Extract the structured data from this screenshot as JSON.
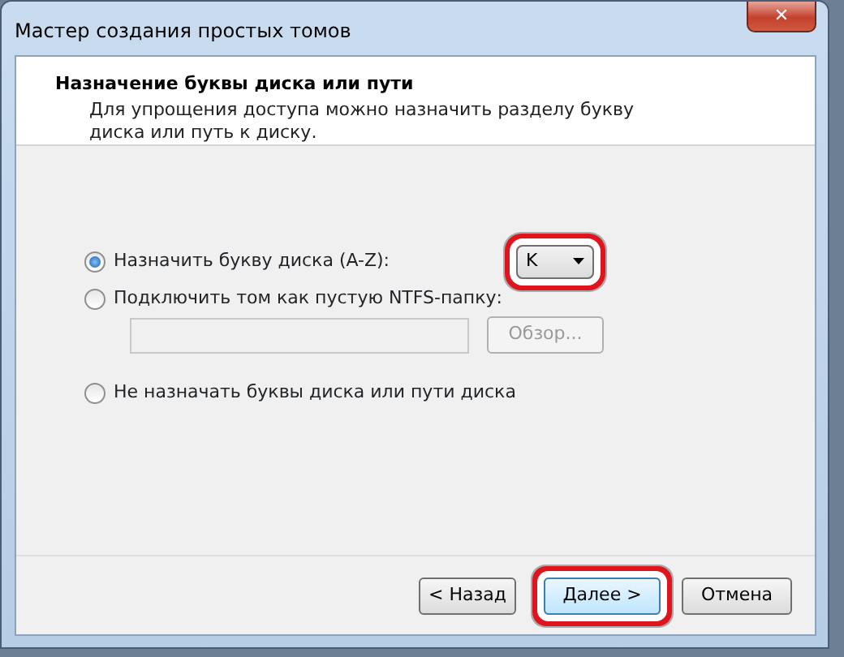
{
  "window": {
    "title": "Мастер создания простых томов",
    "close": "✕"
  },
  "header": {
    "title": "Назначение буквы диска или пути",
    "description": "Для упрощения доступа можно назначить разделу букву диска или путь к диску."
  },
  "options": [
    {
      "label": "Назначить букву диска (A-Z):",
      "selected": true
    },
    {
      "label": "Подключить том как пустую NTFS-папку:",
      "selected": false
    },
    {
      "label": "Не назначать буквы диска или пути диска",
      "selected": false
    }
  ],
  "drive_letter": {
    "value": "K",
    "highlighted": true
  },
  "folder_path": {
    "disabled": true
  },
  "browse_button": {
    "label": "Обзор...",
    "disabled": true
  },
  "buttons": [
    {
      "label": "< Назад",
      "default": false,
      "highlighted": false
    },
    {
      "label": "Далее >",
      "default": true,
      "highlighted": true
    },
    {
      "label": "Отмена",
      "default": false,
      "highlighted": false
    }
  ]
}
